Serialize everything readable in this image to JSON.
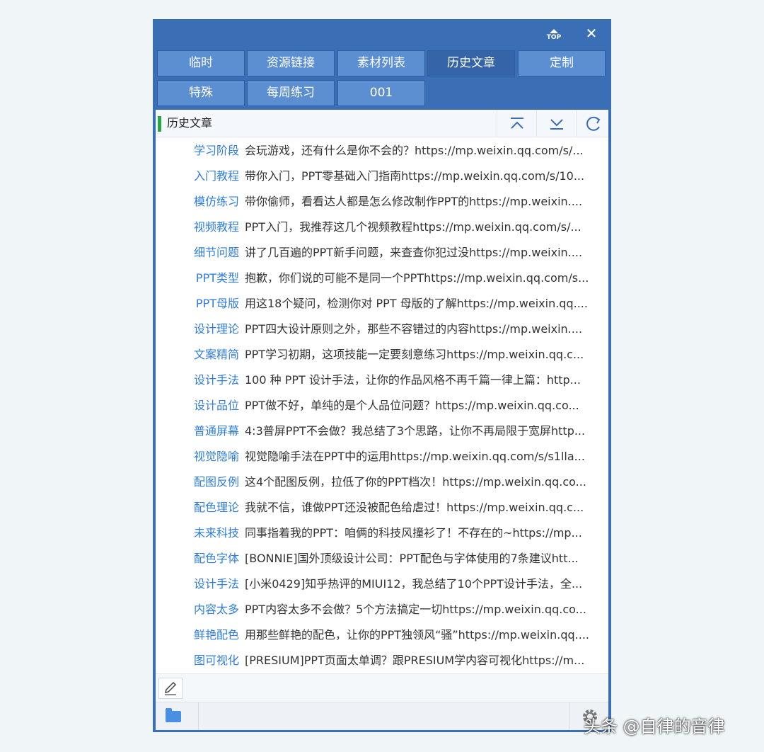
{
  "window": {
    "top_label": "TOP",
    "close_label": "✕"
  },
  "tabs": [
    {
      "label": "临时",
      "active": false
    },
    {
      "label": "资源链接",
      "active": false
    },
    {
      "label": "素材列表",
      "active": false
    },
    {
      "label": "历史文章",
      "active": true
    },
    {
      "label": "定制",
      "active": false
    },
    {
      "label": "特殊",
      "active": false
    },
    {
      "label": "每周练习",
      "active": false
    },
    {
      "label": "001",
      "active": false
    }
  ],
  "panel": {
    "title": "历史文章",
    "buttons": [
      "collapse-up-icon",
      "expand-down-icon",
      "refresh-icon"
    ]
  },
  "items": [
    {
      "key": "学习阶段",
      "value": "会玩游戏，还有什么是你不会的？https://mp.weixin.qq.com/s/..."
    },
    {
      "key": "入门教程",
      "value": "带你入门，PPT零基础入门指南https://mp.weixin.qq.com/s/10..."
    },
    {
      "key": "模仿练习",
      "value": "带你偷师，看看达人都是怎么修改制作PPT的https://mp.weixin...."
    },
    {
      "key": "视频教程",
      "value": "PPT入门，我推荐这几个视频教程https://mp.weixin.qq.com/s/..."
    },
    {
      "key": "细节问题",
      "value": "讲了几百遍的PPT新手问题，来查查你犯过没https://mp.weixin...."
    },
    {
      "key": "PPT类型",
      "value": "抱歉，你们说的可能不是同一个PPThttps://mp.weixin.qq.com/s..."
    },
    {
      "key": "PPT母版",
      "value": "用这18个疑问，检测你对 PPT 母版的了解https://mp.weixin.qq...."
    },
    {
      "key": "设计理论",
      "value": "PPT四大设计原则之外，那些不容错过的内容https://mp.weixin...."
    },
    {
      "key": "文案精简",
      "value": "PPT学习初期，这项技能一定要刻意练习https://mp.weixin.qq.c..."
    },
    {
      "key": "设计手法",
      "value": "100 种 PPT 设计手法，让你的作品风格不再千篇一律上篇：http..."
    },
    {
      "key": "设计品位",
      "value": "PPT做不好，单纯的是个人品位问题？https://mp.weixin.qq.co..."
    },
    {
      "key": "普通屏幕",
      "value": "4:3普屏PPT不会做？我总结了3个思路，让你不再局限于宽屏http..."
    },
    {
      "key": "视觉隐喻",
      "value": "视觉隐喻手法在PPT中的运用https://mp.weixin.qq.com/s/s1lla..."
    },
    {
      "key": "配图反例",
      "value": "这4个配图反例，拉低了你的PPT档次！https://mp.weixin.qq.co..."
    },
    {
      "key": "配色理论",
      "value": "我就不信，谁做PPT还没被配色给虐过！https://mp.weixin.qq.c..."
    },
    {
      "key": "未来科技",
      "value": "同事指着我的PPT：咱俩的科技风撞衫了！不存在的~https://mp..."
    },
    {
      "key": "配色字体",
      "value": "[BONNIE]国外顶级设计公司：PPT配色与字体使用的7条建议htt..."
    },
    {
      "key": "设计手法",
      "value": "[小米0429]知乎热评的MIUI12，我总结了10个PPT设计手法，全..."
    },
    {
      "key": "内容太多",
      "value": "PPT内容太多不会做？5个方法搞定一切https://mp.weixin.qq.co..."
    },
    {
      "key": "鲜艳配色",
      "value": "用那些鲜艳的配色，让你的PPT独领风“骚”https://mp.weixin.qq...."
    },
    {
      "key": "图可视化",
      "value": "[PRESIUM]PPT页面太单调？跟PRESIUM学内容可视化https://m..."
    }
  ],
  "footer": {
    "edit_icon": "pencil-icon",
    "folder_icon": "folder-icon",
    "settings_icon": "gear-icon"
  },
  "watermark": "头条 @自律的音律",
  "colors": {
    "window_blue": "#3a6fb5",
    "tab_blue": "#5b8fd2",
    "tab_active": "#3565a8",
    "key_blue": "#2f7de0",
    "marker_green": "#27a844"
  }
}
